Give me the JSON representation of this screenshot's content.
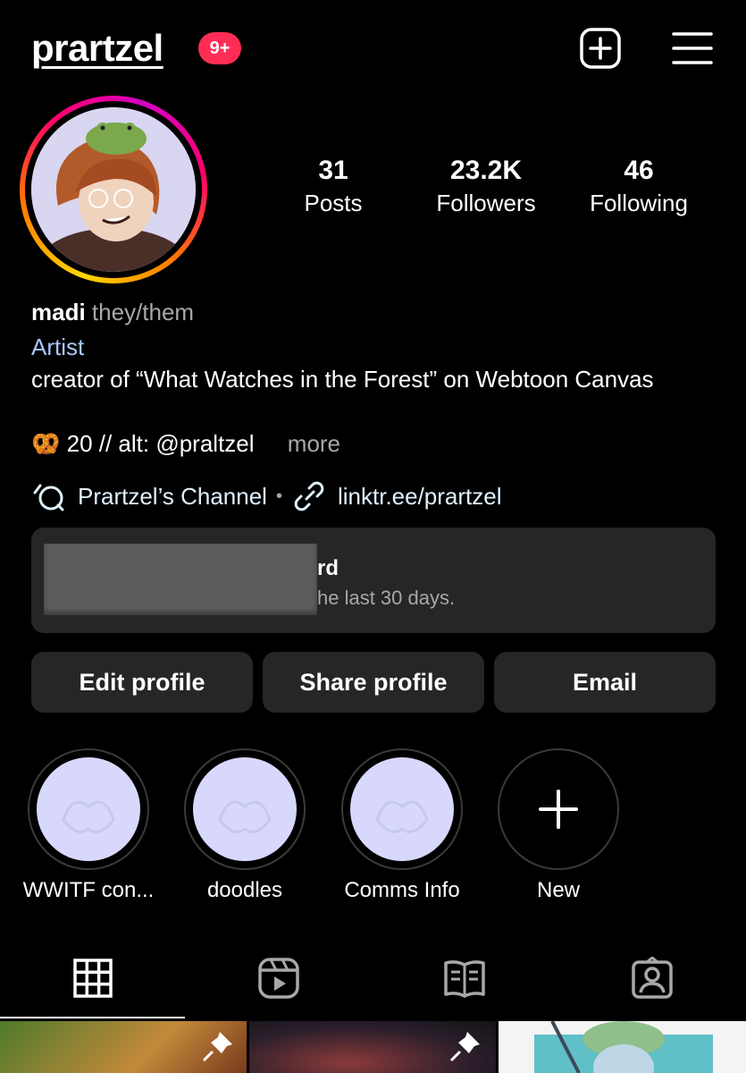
{
  "header": {
    "username": "prartzel",
    "notification_badge": "9+",
    "icons": [
      "create-post-icon",
      "hamburger-menu-icon"
    ]
  },
  "stats": {
    "posts": {
      "value": "31",
      "label": "Posts"
    },
    "followers": {
      "value": "23.2K",
      "label": "Followers"
    },
    "following": {
      "value": "46",
      "label": "Following"
    }
  },
  "bio": {
    "name": "madi",
    "pronouns": "they/them",
    "category": "Artist",
    "description": "creator of “What Watches in the Forest” on Webtoon Canvas",
    "alt_emoji": "🥨",
    "alt_text": "20 // alt: @praltzel",
    "more": "more"
  },
  "links": {
    "channel": "Prartzel’s Channel",
    "link": "linktr.ee/prartzel"
  },
  "dashboard": {
    "title_visible": "rd",
    "subtitle_visible": "he last 30 days."
  },
  "buttons": {
    "edit": "Edit profile",
    "share": "Share profile",
    "email": "Email"
  },
  "highlights": [
    {
      "label": "WWITF con..."
    },
    {
      "label": "doodles"
    },
    {
      "label": "Comms Info"
    },
    {
      "label": "New"
    }
  ],
  "tabs": [
    "grid-tab-icon",
    "reels-tab-icon",
    "guides-tab-icon",
    "tagged-tab-icon"
  ],
  "colors": {
    "background": "#000000",
    "badge": "#ff2d55",
    "card": "#262626",
    "secondary_text": "#a8a8a8",
    "category_text": "#a8c7fa"
  }
}
